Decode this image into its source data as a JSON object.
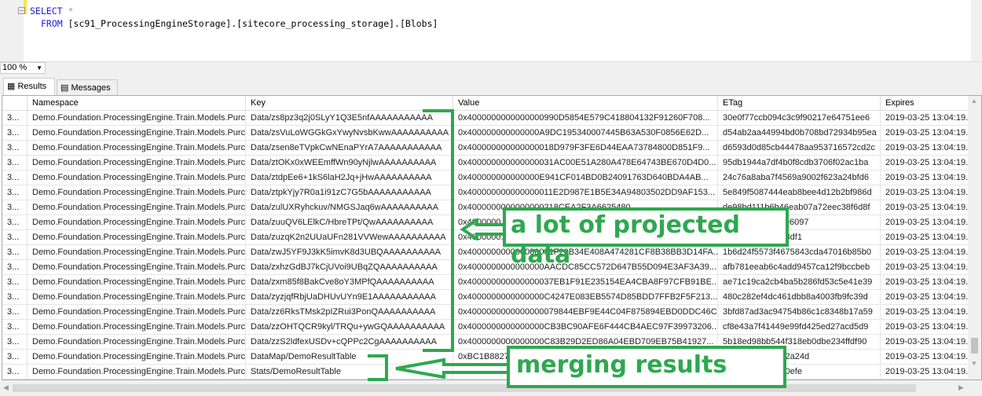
{
  "editor": {
    "line1_kw": "SELECT",
    "line1_rest": " *",
    "line2_kw": "FROM",
    "line2_rest": " [sc91_ProcessingEngineStorage].[sitecore_processing_storage].[Blobs]"
  },
  "zoom": {
    "value": "100 %"
  },
  "tabs": [
    {
      "label": "Results",
      "icon": "grid-icon"
    },
    {
      "label": "Messages",
      "icon": "messages-icon"
    }
  ],
  "columns": [
    "",
    "Namespace",
    "Key",
    "Value",
    "ETag",
    "Expires"
  ],
  "rows": [
    [
      "3...",
      "Demo.Foundation.ProcessingEngine.Train.Models.Purc",
      "Data/zs8pz3q2j0SLyY1Q3E5nfAAAAAAAAAAA",
      "0x4000000000000000990D5854E579C418804132F91260F708...",
      "30e0f77ccb094c3c9f90217e64751ee6",
      "2019-03-25 13:04:19.8"
    ],
    [
      "3...",
      "Demo.Foundation.ProcessingEngine.Train.Models.Purc",
      "Data/zsVuLoWGGkGxYwyNvsbKwwAAAAAAAAAA",
      "0x400000000000000A9DC195340007445B63A530F0856E62D...",
      "d54ab2aa44994bd0b708bd72934b95ea",
      "2019-03-25 13:04:19.5"
    ],
    [
      "3...",
      "Demo.Foundation.ProcessingEngine.Train.Models.Purc",
      "Data/zsen8eTVpkCwNEnaPYrA7AAAAAAAAAAA",
      "0x400000000000000018D979F3FE6D44EAA73784800D851F9...",
      "d6593d0d85cb44478aa953716572cd2c",
      "2019-03-25 13:04:19.5"
    ],
    [
      "3...",
      "Demo.Foundation.ProcessingEngine.Train.Models.Purc",
      "Data/ztOKx0xWEEmffWn90yNjlwAAAAAAAAAA",
      "0x400000000000000031AC00E51A280A478E64743BE670D4D0...",
      "95db1944a7df4b0f8cdb3706f02ac1ba",
      "2019-03-25 13:04:19.5"
    ],
    [
      "3...",
      "Demo.Foundation.ProcessingEngine.Train.Models.Purc",
      "Data/ztdpEe6+1kS6laH2Jq+jHwAAAAAAAAAA",
      "0x400000000000000E941CF014BD0B24091763D640BDA4AB...",
      "24c76a8aba7f4569a9002f623a24bfd6",
      "2019-03-25 13:04:19.7"
    ],
    [
      "3...",
      "Demo.Foundation.ProcessingEngine.Train.Models.Purc",
      "Data/ztpkYjy7R0a1i91zC7G5bAAAAAAAAAAA",
      "0x400000000000000011E2D987E1B5E34A94803502DD9AF153...",
      "5e849f5087444eab8bee4d12b2bf986d",
      "2019-03-25 13:04:19.7"
    ],
    [
      "3...",
      "Demo.Foundation.ProcessingEngine.Train.Models.Purc",
      "Data/zulUXRyhckuv/NMGSJaq6wAAAAAAAAAA",
      "0x4000000000000000218CEA2F3A6625480...",
      "de98bd111b6b46eab07a72eec38f6d8f",
      "2019-03-25 13:04:19.8"
    ],
    [
      "3...",
      "Demo.Foundation.ProcessingEngine.Train.Models.Purc",
      "Data/zuuQV6LElkC/HbreTPt/QwAAAAAAAAAA",
      "0x4000000...",
      "12aed5c6246b696097",
      "2019-03-25 13:04:19.6"
    ],
    [
      "3...",
      "Demo.Foundation.ProcessingEngine.Train.Models.Purc",
      "Data/zuzqK2n2UUaUFn281VVWewAAAAAAAAAA",
      "0x4000000...",
      "0ba9682bdd85a3df1",
      "2019-03-25 13:04:19.5"
    ],
    [
      "3...",
      "Demo.Foundation.ProcessingEngine.Train.Models.Purc",
      "Data/zwJ5YF9J3kK5imvK8d3UBQAAAAAAAAAA",
      "0x400000000000000001F20B34E408A474281CF8B38BB3D14FA...",
      "1b6d24f5573f4675843cda47016b85b0",
      "2019-03-25 13:04:19.8"
    ],
    [
      "3...",
      "Demo.Foundation.ProcessingEngine.Train.Models.Purc",
      "Data/zxhzGdBJ7kCjUVoi9UBqZQAAAAAAAAAA",
      "0x4000000000000000AACDC85CC572D647B55D094E3AF3A39...",
      "afb781eeab6c4add9457ca12f9bccbeb",
      "2019-03-25 13:04:19.7"
    ],
    [
      "3...",
      "Demo.Foundation.ProcessingEngine.Train.Models.Purc",
      "Data/zxm85f8BakCve8oY3MPfQAAAAAAAAAA",
      "0x400000000000000037EB1F91E235154EA4CBA8F97CFB91BE...",
      "ae71c19ca2cb4ba5b286fd53c5e41e39",
      "2019-03-25 13:04:19.8"
    ],
    [
      "3...",
      "Demo.Foundation.ProcessingEngine.Train.Models.Purc",
      "Data/zyzjqfRbjUaDHUvUYn9E1AAAAAAAAAAA",
      "0x4000000000000000C4247E083EB5574D85BDD7FFB2F5F213...",
      "480c282ef4dc461dbb8a4003fb9fc39d",
      "2019-03-25 13:04:19.7"
    ],
    [
      "3...",
      "Demo.Foundation.ProcessingEngine.Train.Models.Purc",
      "Data/zz6RksTMsk2pIZRui3PonQAAAAAAAAAA",
      "0x4000000000000000079844EBF9E44C04F875894EBD0DDC46C...",
      "3bfd87ad3ac94754b86c1c8348b17a59",
      "2019-03-25 13:04:19.8"
    ],
    [
      "3...",
      "Demo.Foundation.ProcessingEngine.Train.Models.Purc",
      "Data/zzOHTQCR9kyl/TRQu+ywGQAAAAAAAAAA",
      "0x4000000000000000CB3BC90AFE6F444CB4AEC97F39973206...",
      "cf8e43a7f41449e99fd425ed27acd5d9",
      "2019-03-25 13:04:19.5"
    ],
    [
      "3...",
      "Demo.Foundation.ProcessingEngine.Train.Models.Purc",
      "Data/zzS2ldfexUSDv+cQPPc2CgAAAAAAAAAA",
      "0x4000000000000000C83B29D2ED86A04EBD709EB75B41927...",
      "5b18ed98bb544f318eb0dbe234ffdf90",
      "2019-03-25 13:04:19.7"
    ],
    [
      "3...",
      "Demo.Foundation.ProcessingEngine.Train.Models.Purc",
      "DataMap/DemoResultTable",
      "0xBC1B8827",
      "a5b2e1858732d2a24d",
      "2019-03-25 13:04:19.5"
    ],
    [
      "3...",
      "Demo.Foundation.ProcessingEngine.Train.Models.Purc",
      "Stats/DemoResultTable",
      "",
      "89773694d07e50efe",
      "2019-03-25 13:04:19.5"
    ]
  ],
  "annotations": {
    "projected": "a lot of projected  data",
    "merging": "merging results",
    "color": "#2ea84f"
  }
}
